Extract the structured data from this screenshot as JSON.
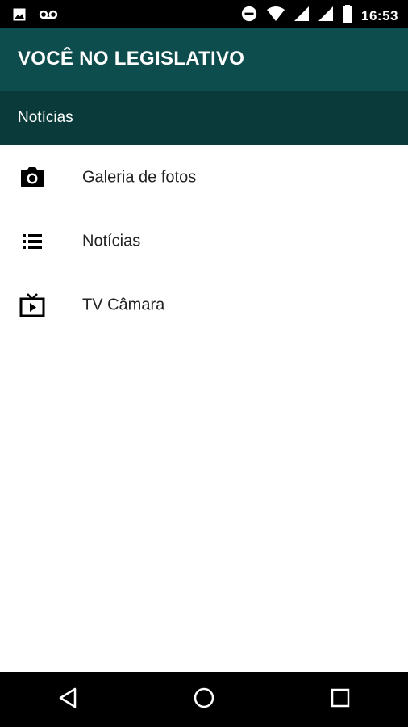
{
  "status_bar": {
    "time": "16:53",
    "icons": [
      "image-icon",
      "voicemail-icon",
      "do-not-disturb-icon",
      "wifi-icon",
      "signal-icon",
      "signal-icon-2",
      "battery-icon"
    ]
  },
  "app_bar": {
    "title": "VOCÊ NO LEGISLATIVO"
  },
  "section_header": {
    "title": "Notícias"
  },
  "menu": {
    "items": [
      {
        "label": "Galeria de fotos",
        "icon": "camera-icon"
      },
      {
        "label": "Notícias",
        "icon": "list-icon"
      },
      {
        "label": "TV Câmara",
        "icon": "tv-icon"
      }
    ]
  },
  "nav_bar": {
    "buttons": [
      "back-icon",
      "home-icon",
      "recents-icon"
    ]
  },
  "colors": {
    "app_bar": "#0d4d4d",
    "section_header": "#0a3a3a",
    "status_bar": "#000000"
  }
}
